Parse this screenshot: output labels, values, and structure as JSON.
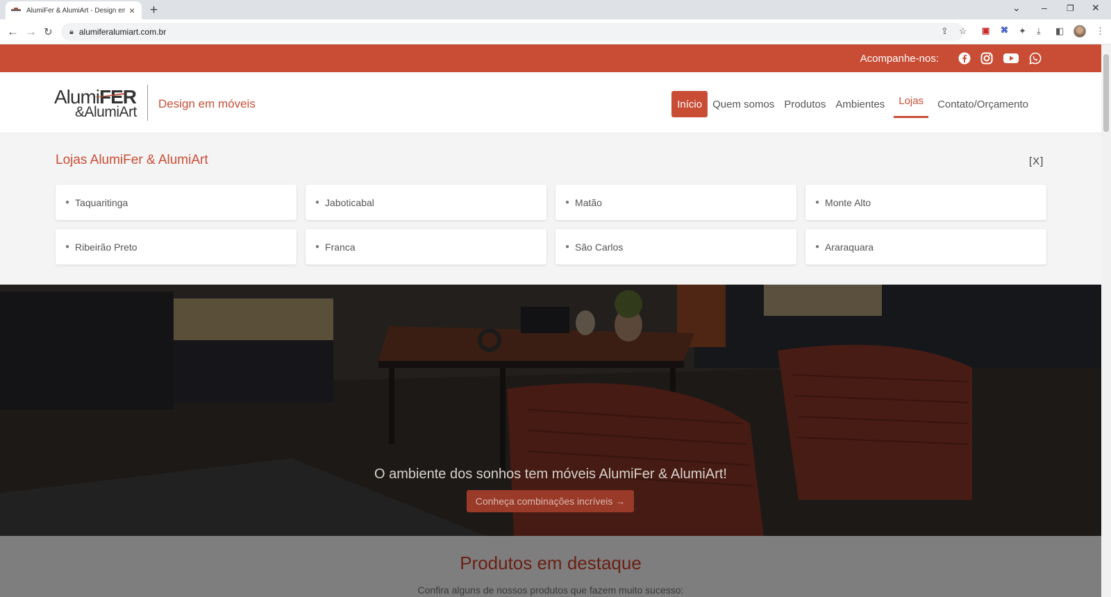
{
  "browser": {
    "tab_title": "AlumiFer & AlumiArt - Design em",
    "url": "alumiferalumiart.com.br"
  },
  "topbar": {
    "follow_label": "Acompanhe-nos:",
    "social": [
      "facebook-icon",
      "instagram-icon",
      "youtube-icon",
      "whatsapp-icon"
    ]
  },
  "header": {
    "logo": {
      "line1_a": "Alumi",
      "line1_b": "FER",
      "line2": "&AlumiArt"
    },
    "tagline": "Design em móveis",
    "nav": [
      {
        "label": "Início"
      },
      {
        "label": "Quem somos"
      },
      {
        "label": "Produtos"
      },
      {
        "label": "Ambientes"
      },
      {
        "label": "Lojas"
      },
      {
        "label": "Contato/Orçamento"
      }
    ]
  },
  "stores": {
    "title": "Lojas AlumiFer & AlumiArt",
    "close_label": "[X]",
    "items": [
      {
        "name": "Taquaritinga"
      },
      {
        "name": "Jaboticabal"
      },
      {
        "name": "Matão"
      },
      {
        "name": "Monte Alto"
      },
      {
        "name": "Ribeirão Preto"
      },
      {
        "name": "Franca"
      },
      {
        "name": "São Carlos"
      },
      {
        "name": "Araraquara"
      }
    ]
  },
  "hero": {
    "caption": "O ambiente dos sonhos tem móveis AlumiFer & AlumiArt!",
    "button_label": "Conheça combinações incríveis →"
  },
  "featured": {
    "title": "Produtos em destaque",
    "subtitle": "Confira alguns de nossos produtos que fazem muito sucesso:"
  },
  "colors": {
    "brand": "#c94d35",
    "hero_button": "#9a3a29"
  }
}
